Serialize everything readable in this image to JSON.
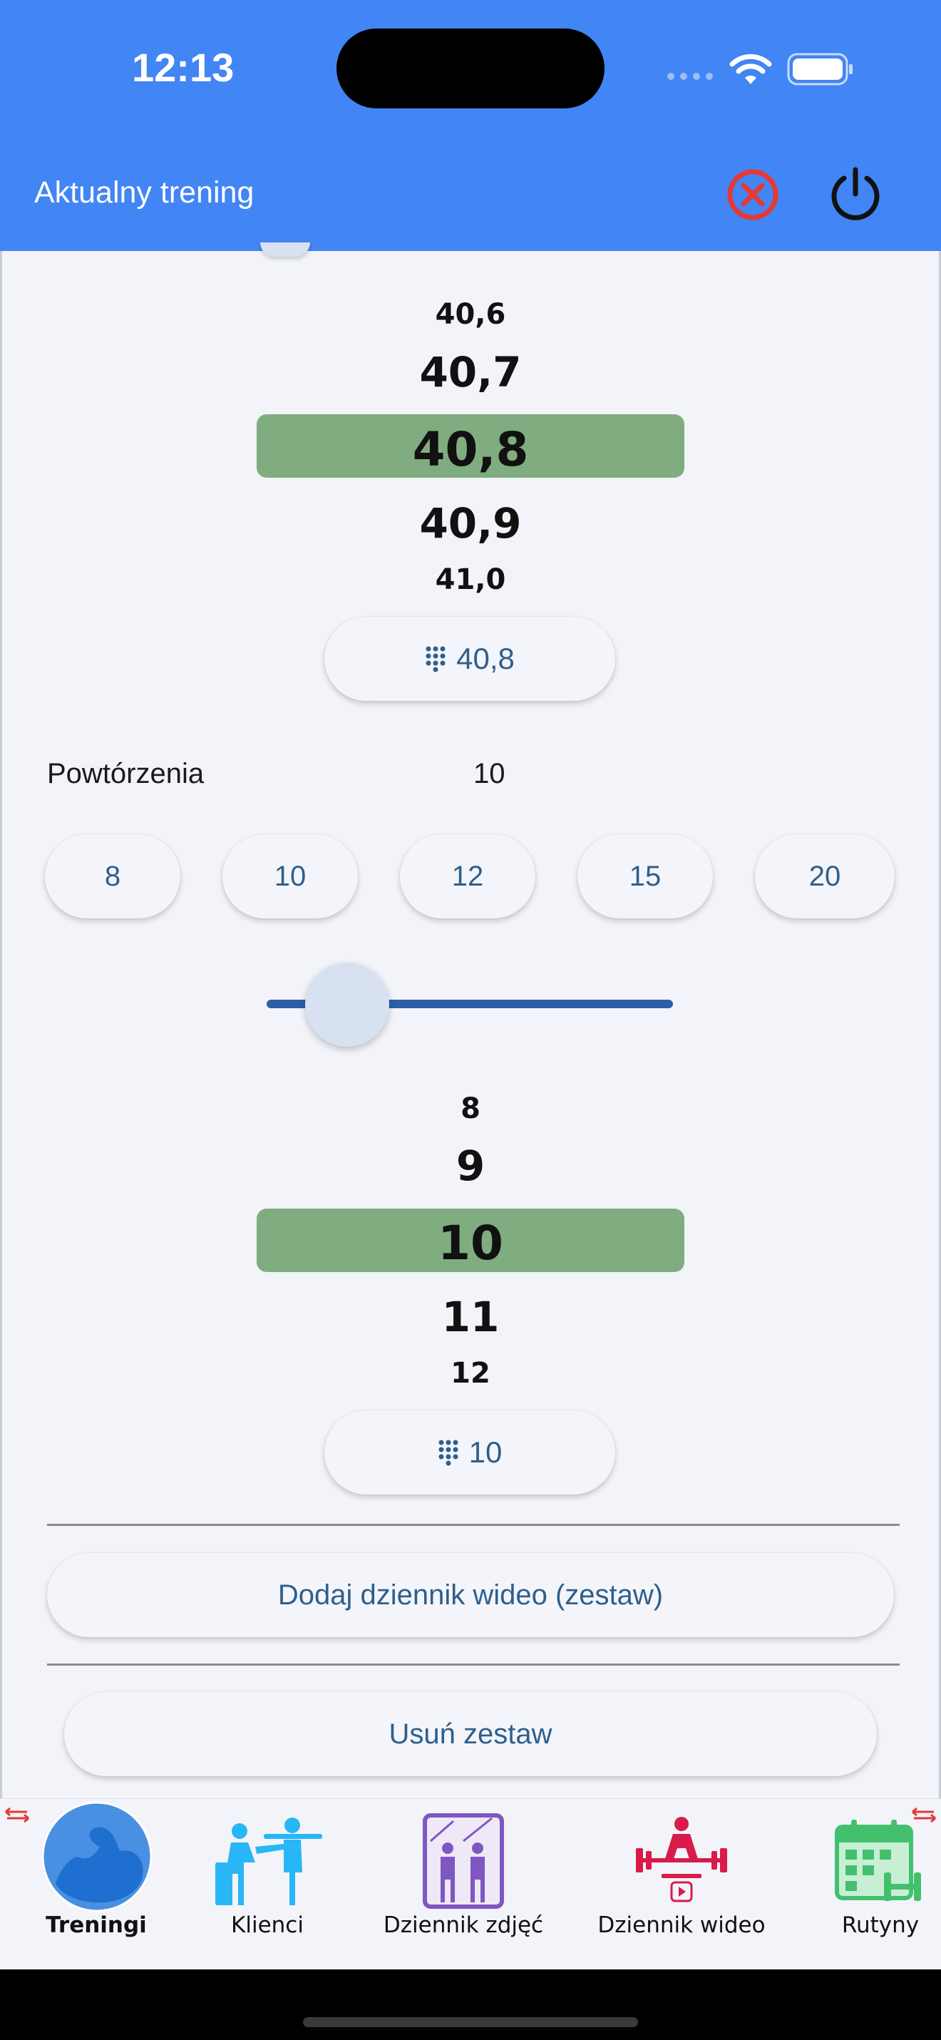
{
  "status_bar": {
    "time": "12:13"
  },
  "app_bar": {
    "title": "Aktualny trening"
  },
  "weight_picker": {
    "items": [
      "40,6",
      "40,7",
      "40,8",
      "40,9",
      "41,0"
    ],
    "selected": "40,8",
    "input_value": "40,8"
  },
  "reps": {
    "label": "Powtórzenia",
    "value": "10",
    "chips": [
      "8",
      "10",
      "12",
      "15",
      "20"
    ],
    "slider_fraction": 0.1,
    "picker_items": [
      "8",
      "9",
      "10",
      "11",
      "12"
    ],
    "selected": "10",
    "input_value": "10"
  },
  "actions": {
    "add_video_log": "Dodaj dziennik wideo (zestaw)",
    "delete_set": "Usuń zestaw"
  },
  "bottom_nav": {
    "items": [
      {
        "label": "Treningi",
        "icon": "flexed-arm-icon",
        "active": true
      },
      {
        "label": "Klienci",
        "icon": "trainer-client-icon",
        "active": false
      },
      {
        "label": "Dziennik zdjęć",
        "icon": "mirror-photo-icon",
        "active": false
      },
      {
        "label": "Dziennik wideo",
        "icon": "weightlifter-video-icon",
        "active": false
      },
      {
        "label": "Rutyny",
        "icon": "calendar-dumbbell-icon",
        "active": false
      }
    ]
  },
  "colors": {
    "app_bar": "#4285f4",
    "selection": "#80ad80",
    "accent_text": "#2f5f8c",
    "close_red": "#e53935"
  }
}
